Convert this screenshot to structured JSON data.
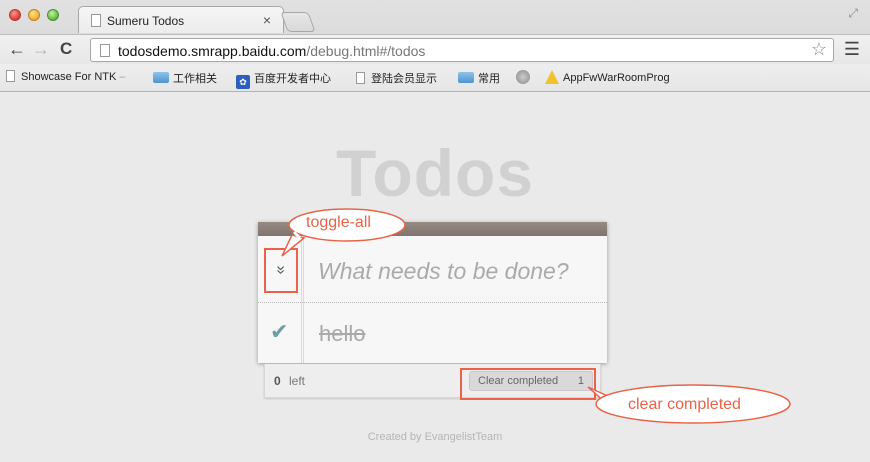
{
  "browser": {
    "tab_title": "Sumeru Todos",
    "tab_close": "×",
    "url_host": "todosdemo.smrapp.baidu.com",
    "url_path": "/debug.html#/todos",
    "back_glyph": "←",
    "forward_glyph": "→",
    "reload_glyph": "C",
    "star_glyph": "☆",
    "menu_glyph": "☰",
    "fullscreen_glyph": "⤢"
  },
  "bookmarks": [
    {
      "label": "Showcase For NTK",
      "icon": "page-icon"
    },
    {
      "label": "工作相关",
      "icon": "folder-icon"
    },
    {
      "label": "百度开发者中心",
      "icon": "baidu-paw-icon"
    },
    {
      "label": "登陆会员显示",
      "icon": "page-icon"
    },
    {
      "label": "常用",
      "icon": "folder-icon"
    },
    {
      "label": "",
      "icon": "globe-icon"
    },
    {
      "label": "AppFwWarRoomProg",
      "icon": "warning-icon"
    }
  ],
  "app": {
    "title": "Todos",
    "new_todo_placeholder": "What needs to be done?",
    "toggle_all_glyph": "»",
    "todos": [
      {
        "text": "hello",
        "completed": true,
        "check_glyph": "✔"
      }
    ],
    "footer": {
      "count": "0",
      "left_label": "left",
      "clear_label": "Clear completed",
      "clear_count": "1"
    },
    "credit": "Created by EvangelistTeam"
  },
  "annotations": {
    "toggle_all": "toggle-all",
    "clear_completed": "clear completed",
    "color": "#e8634a"
  },
  "colors": {
    "header_bar": "#8a7f7a",
    "check": "#6b9fa3",
    "title": "#d1d1d1"
  }
}
